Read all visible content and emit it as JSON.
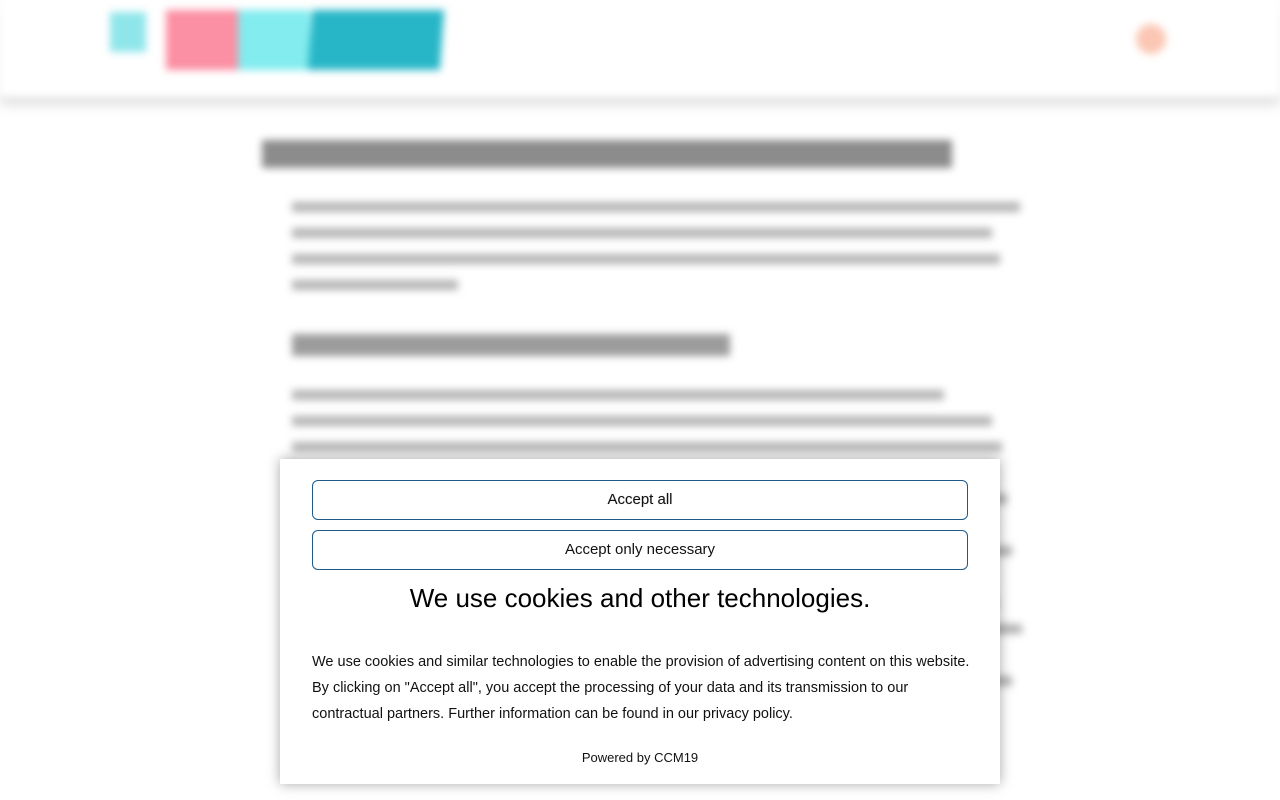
{
  "cookie_banner": {
    "accept_all_label": "Accept all",
    "accept_necessary_label": "Accept only necessary",
    "title": "We use cookies and other technologies.",
    "body": "We use cookies and similar technologies to enable the provision of advertising content on this website. By clicking on \"Accept all\", you accept the processing of your data and its transmission to our contractual partners. Further information can be found in our privacy policy.",
    "powered_by_prefix": "Powered by ",
    "powered_by_link": "CCM19",
    "button_border_color": "#1f5a8a"
  },
  "background": {
    "logo_colors": [
      "#8fe6ea",
      "#fb8fa3",
      "#82ecef",
      "#27b6c7"
    ],
    "menu_icon": "menu-icon"
  }
}
